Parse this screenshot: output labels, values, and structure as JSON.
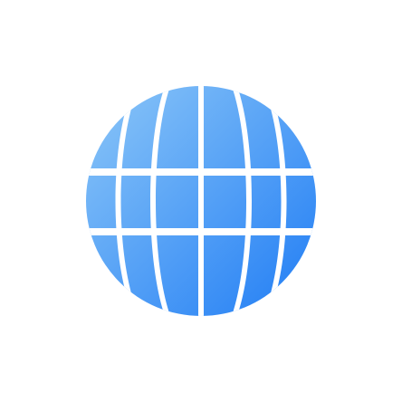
{
  "icon": {
    "name": "globe-icon",
    "gradient_start": "#8EC8F8",
    "gradient_end": "#1E7BF4"
  }
}
